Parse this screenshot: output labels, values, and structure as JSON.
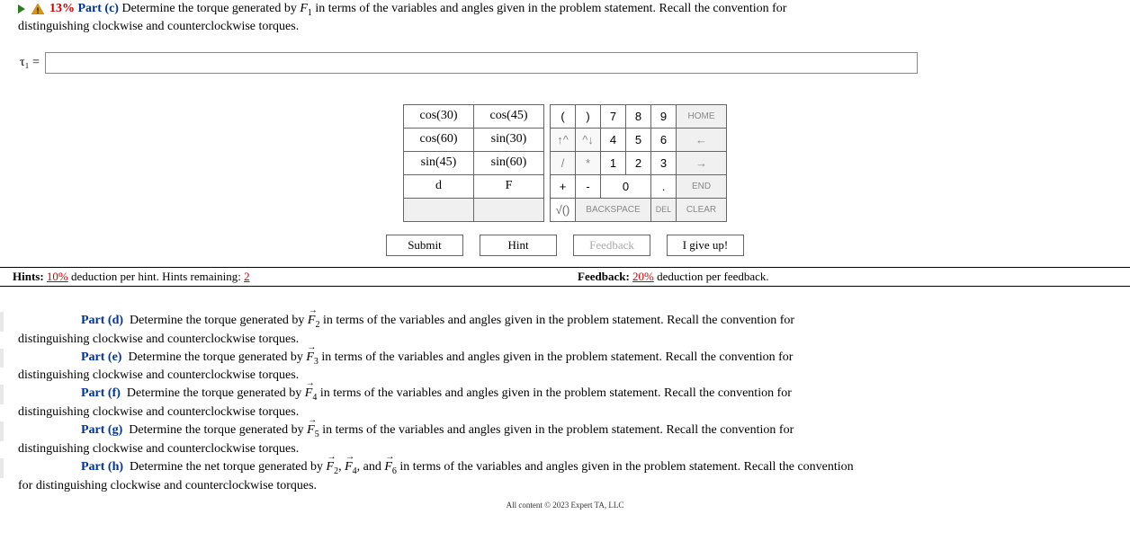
{
  "partC": {
    "percent": "13%",
    "label": "Part (c)",
    "force": "F",
    "forceSub": "1",
    "text1": "Determine the torque generated by ",
    "text2": " in terms of the variables and angles given in the problem statement. Recall the convention for",
    "cont": "distinguishing clockwise and counterclockwise torques."
  },
  "input": {
    "tauLabel": "τ₁ =",
    "value": ""
  },
  "funcKeys": {
    "r0c0": "cos(30)",
    "r0c1": "cos(45)",
    "r1c0": "cos(60)",
    "r1c1": "sin(30)",
    "r2c0": "sin(45)",
    "r2c1": "sin(60)",
    "r3c0": "d",
    "r3c1": "F"
  },
  "numKeys": {
    "lparen": "(",
    "rparen": ")",
    "k7": "7",
    "k8": "8",
    "k9": "9",
    "home": "HOME",
    "upL": "↑^",
    "upR": "^↓",
    "k4": "4",
    "k5": "5",
    "k6": "6",
    "left": "←",
    "slash": "/",
    "star": "*",
    "k1": "1",
    "k2": "2",
    "k3": "3",
    "right": "→",
    "plus": "+",
    "minus": "-",
    "k0": "0",
    "dot": ".",
    "end": "END",
    "sqrt": "√()",
    "back": "BACKSPACE",
    "del": "DEL",
    "clear": "CLEAR"
  },
  "actions": {
    "submit": "Submit",
    "hint": "Hint",
    "feedback": "Feedback",
    "giveup": "I give up!"
  },
  "hints": {
    "label": "Hints:",
    "pct": "10%",
    "text1": " deduction per hint. Hints remaining: ",
    "remaining": "2"
  },
  "feedback": {
    "label": "Feedback:",
    "pct": "20%",
    "text1": " deduction per feedback."
  },
  "otherParts": [
    {
      "label": "Part (d)",
      "force": "F",
      "sub": "2",
      "pre": "Determine the torque generated by ",
      "post": " in terms of the variables and angles given in the problem statement. Recall the convention for",
      "cont": "distinguishing clockwise and counterclockwise torques."
    },
    {
      "label": "Part (e)",
      "force": "F",
      "sub": "3",
      "pre": "Determine the torque generated by ",
      "post": " in terms of the variables and angles given in the problem statement. Recall the convention for",
      "cont": "distinguishing clockwise and counterclockwise torques."
    },
    {
      "label": "Part (f)",
      "force": "F",
      "sub": "4",
      "pre": "Determine the torque generated by ",
      "post": " in terms of the variables and angles given in the problem statement. Recall the convention for",
      "cont": "distinguishing clockwise and counterclockwise torques."
    },
    {
      "label": "Part (g)",
      "force": "F",
      "sub": "5",
      "pre": "Determine the torque generated by ",
      "post": " in terms of the variables and angles given in the problem statement. Recall the convention for",
      "cont": "distinguishing clockwise and counterclockwise torques."
    }
  ],
  "partH": {
    "label": "Part (h)",
    "pre": "Determine the net torque generated by ",
    "forces": [
      "F₂",
      "F₄",
      "F₆"
    ],
    "joinComma": ", ",
    "joinAnd": ", and ",
    "post": " in terms of the variables and angles given in the problem statement. Recall the convention",
    "cont": "for distinguishing clockwise and counterclockwise torques."
  },
  "footer": "All content © 2023 Expert TA, LLC"
}
